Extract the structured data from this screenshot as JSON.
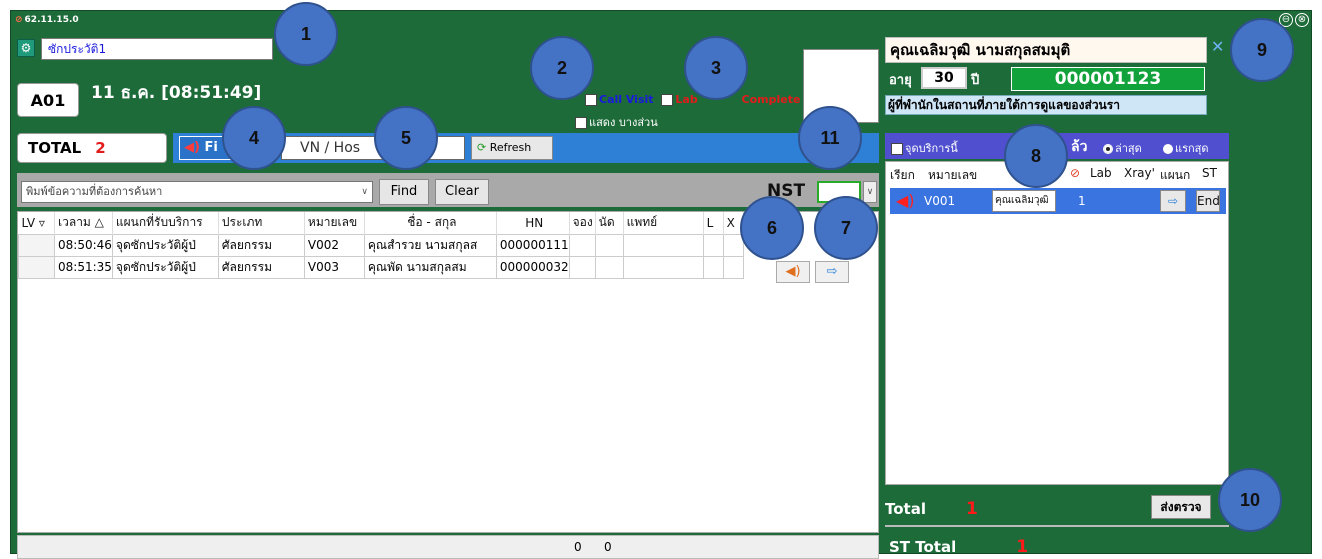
{
  "window": {
    "title": "62.11.15.0",
    "minimize_glyph": "⊖",
    "close_glyph": "⊗"
  },
  "left": {
    "station_name": "ซักประวัติ1",
    "queue_code": "A01",
    "datetime": "11 ธ.ค. [08:51:49]",
    "options": {
      "call_visit": "Call Visit",
      "lab": "Lab",
      "complete": "Complete",
      "show_partial": "แสดง บางส่วน"
    },
    "total_label": "TOTAL",
    "total_value": "2",
    "fire_label": "Fi",
    "vn_placeholder": "VN / Hos",
    "refresh_label": "Refresh",
    "search_placeholder": "พิมพ์ข้อความที่ต้องการค้นหา",
    "find_label": "Find",
    "clear_label": "Clear",
    "nst_label": "NST",
    "columns": [
      "LV",
      "เวลาม",
      "แผนกที่รับบริการ",
      "ประเภท",
      "หมายเลข",
      "ชื่อ - สกุล",
      "HN",
      "จอง",
      "นัด",
      "แพทย์",
      "L",
      "X"
    ],
    "rows": [
      {
        "time": "08:50:46",
        "dept": "จุดซักประวัติผู้ป่",
        "type": "ศัลยกรรม",
        "number": "V002",
        "name": "คุณสำรวย  นามสกุลส",
        "hn": "000000111"
      },
      {
        "time": "08:51:35",
        "dept": "จุดซักประวัติผู้ป่",
        "type": "ศัลยกรรม",
        "number": "V003",
        "name": "คุณพัด  นามสกุลสม",
        "hn": "000000032"
      }
    ],
    "footer_a": "0",
    "footer_b": "0"
  },
  "right": {
    "patient_name": "คุณเฉลิมวุฒิ  นามสกุลสมมุติ",
    "age_label": "อายุ",
    "age_value": "30",
    "year_label": "ปี",
    "hn": "000001123",
    "info_text": "ผู้ที่พำนักในสถานที่ภายใต้การดูแลของส่วนรา",
    "service_point_label": "จุดบริการนี้",
    "sort_latest": "ล่าสุด",
    "sort_first": "แรกสุด",
    "header_suffix": "ล้ว",
    "columns": [
      "เรียก",
      "หมายเลข",
      "Lab",
      "Xray'",
      "แผนก",
      "ST"
    ],
    "row": {
      "number": "V001",
      "name": "คุณเฉลิมวุฒิ",
      "lab_count": "1",
      "end_label": "End"
    },
    "total_label": "Total",
    "total_value": "1",
    "send_label": "ส่งตรวจ",
    "st_total_label": "ST Total",
    "st_total_value": "1"
  },
  "callouts": [
    "1",
    "2",
    "3",
    "4",
    "5",
    "6",
    "7",
    "8",
    "9",
    "10",
    "11"
  ]
}
